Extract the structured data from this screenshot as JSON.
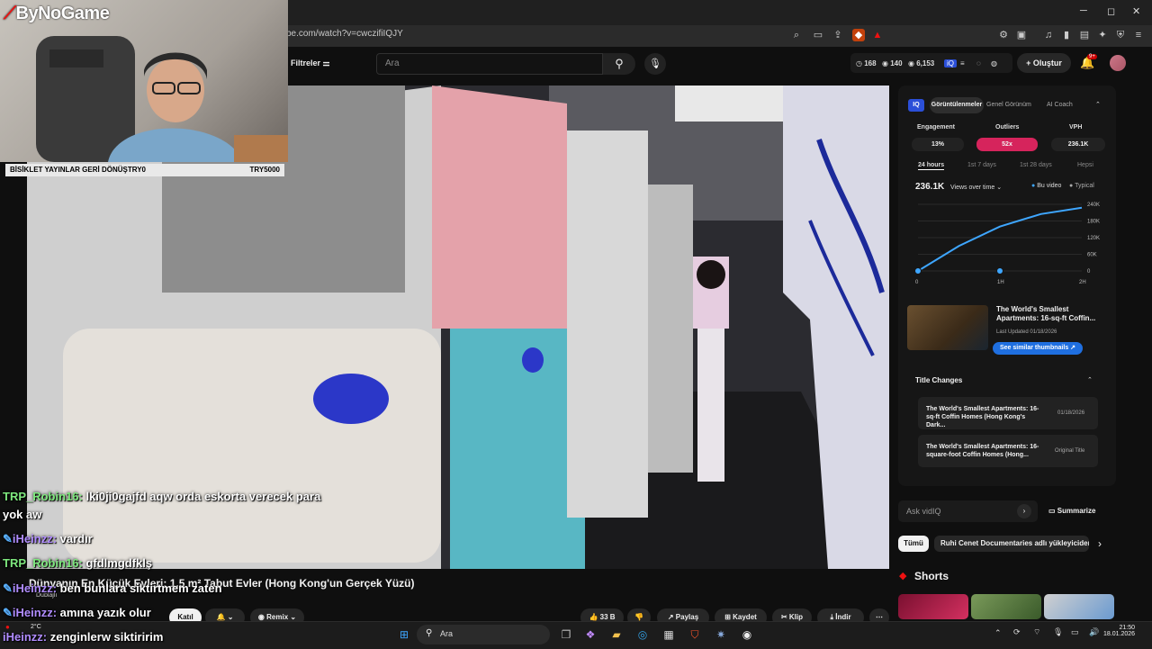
{
  "browser": {
    "url": "be.com/watch?v=cwczifiIQJY"
  },
  "youtube": {
    "filters_label": "Filtreler",
    "search_placeholder": "Ara",
    "stats": {
      "a": "168",
      "b": "140",
      "c": "6,153"
    },
    "create_label": "Oluştur",
    "notif_badge": "9+"
  },
  "facecam": {
    "logo": "ByNoGame",
    "ticker_left": "BİSİKLET YAYINLAR GERİ DÖNÜŞTRY0",
    "ticker_right": "TRY5000"
  },
  "chat": [
    {
      "user": "TRP_Robin16:",
      "color": "green",
      "msg": "lki0ji0gajfd aqw orda eskorta verecek para",
      "cont": "yok aw"
    },
    {
      "user": "iHeinzz:",
      "color": "purple",
      "msg": "vardır"
    },
    {
      "user": "TRP_Robin16:",
      "color": "green",
      "msg": "gfdlmgdfklş"
    },
    {
      "user": "iHeinzz:",
      "color": "purple",
      "msg": "ben bunlara siktirtmem zaten"
    },
    {
      "user": "iHeinzz:",
      "color": "purple",
      "msg": "amına yazık olur"
    },
    {
      "user": "iHeinzz:",
      "color": "purple",
      "msg": "zenginlerw siktiririm"
    }
  ],
  "video": {
    "title": "Dünyanın En Küçük Evleri: 1,5 m² Tabut Evler (Hong Kong'un Gerçek Yüzü)",
    "dubbed": "Dublajlı",
    "join": "Katıl",
    "remix": "Remix",
    "likes": "33 B",
    "share": "Paylaş",
    "save": "Kaydet",
    "clip": "Klip",
    "download": "İndir"
  },
  "vidiq": {
    "tabs": [
      "Görüntülenmeler",
      "Genel Görünüm",
      "AI Coach"
    ],
    "metrics": [
      {
        "label": "Engagement",
        "value": "13%"
      },
      {
        "label": "Outliers",
        "value": "52x"
      },
      {
        "label": "VPH",
        "value": "236.1K"
      }
    ],
    "ranges": [
      "24 hours",
      "1st 7 days",
      "1st 28 days",
      "Hepsi"
    ],
    "views_total": "236.1K",
    "views_dropdown": "Views over time",
    "legend_this": "Bu video",
    "legend_typical": "Typical",
    "thumb_title": "The World's Smallest Apartments: 16-sq-ft Coffin...",
    "thumb_updated": "Last Updated 01/18/2026",
    "see_similar": "See similar thumbnails",
    "title_changes_header": "Title Changes",
    "title_changes": [
      {
        "title": "The World's Smallest Apartments: 16-sq-ft Coffin Homes (Hong Kong's Dark...",
        "date": "01/18/2026"
      },
      {
        "title": "The World's Smallest Apartments: 16-square-foot Coffin Homes (Hong...",
        "date": "Original Title"
      }
    ],
    "ask_placeholder": "Ask vidIQ",
    "summarize": "Summarize"
  },
  "chart_data": {
    "type": "line",
    "x": [
      "0",
      "1H",
      "2H"
    ],
    "xlabel": "",
    "ylabel": "",
    "yticks": [
      "240K",
      "180K",
      "120K",
      "60K",
      "0"
    ],
    "ylim": [
      0,
      240000
    ],
    "series": [
      {
        "name": "Bu video",
        "points": [
          [
            0,
            0
          ],
          [
            0.5,
            90000
          ],
          [
            1,
            160000
          ],
          [
            1.5,
            205000
          ],
          [
            2,
            228000
          ]
        ]
      }
    ]
  },
  "chips": [
    "Tümü",
    "Ruhi Cenet Documentaries adlı yükleyiciden"
  ],
  "shorts_label": "Shorts",
  "taskbar": {
    "search": "Ara",
    "temp": "2°C",
    "time": "21:50",
    "date": "18.01.2026"
  }
}
